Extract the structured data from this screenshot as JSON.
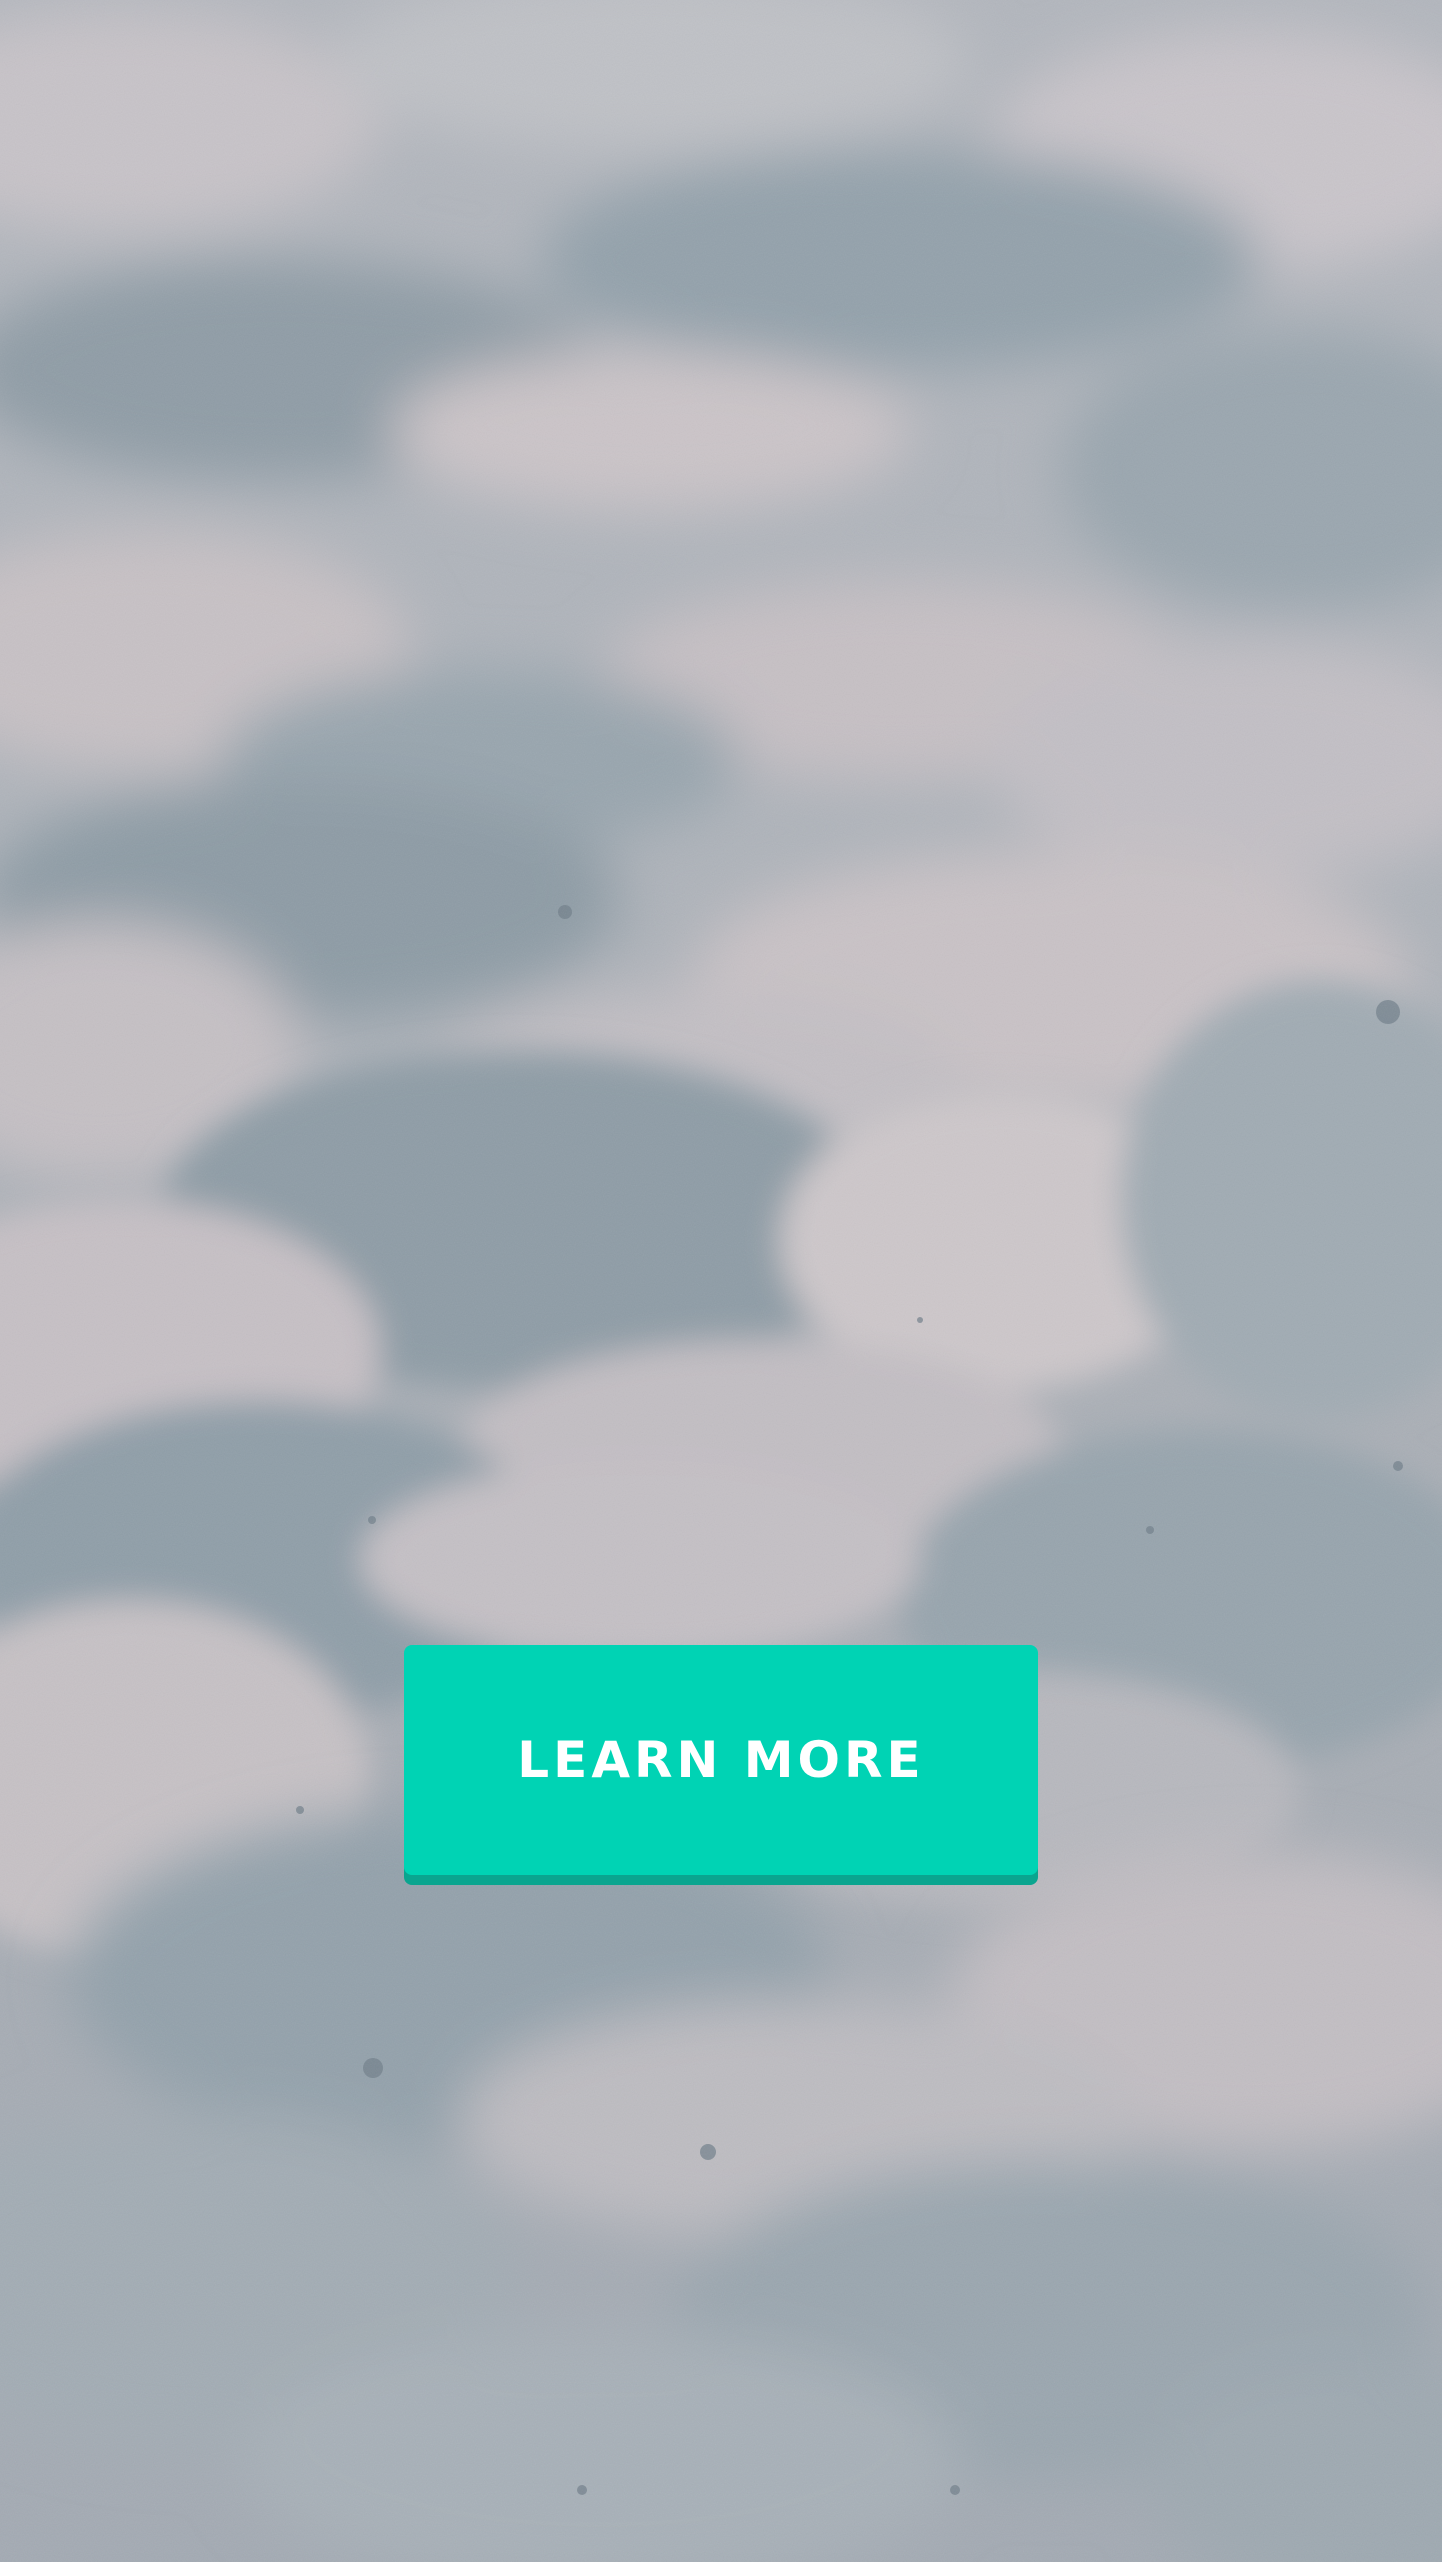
{
  "background": {
    "icon": "sand-dunes-photo",
    "colors": {
      "light": "#c4c2c7",
      "mid": "#a7adb5",
      "shadow": "#8d9aa5"
    }
  },
  "cta": {
    "label": "LEARN MORE",
    "color": "#00d3b4",
    "shadow_color": "#0aa58f"
  }
}
